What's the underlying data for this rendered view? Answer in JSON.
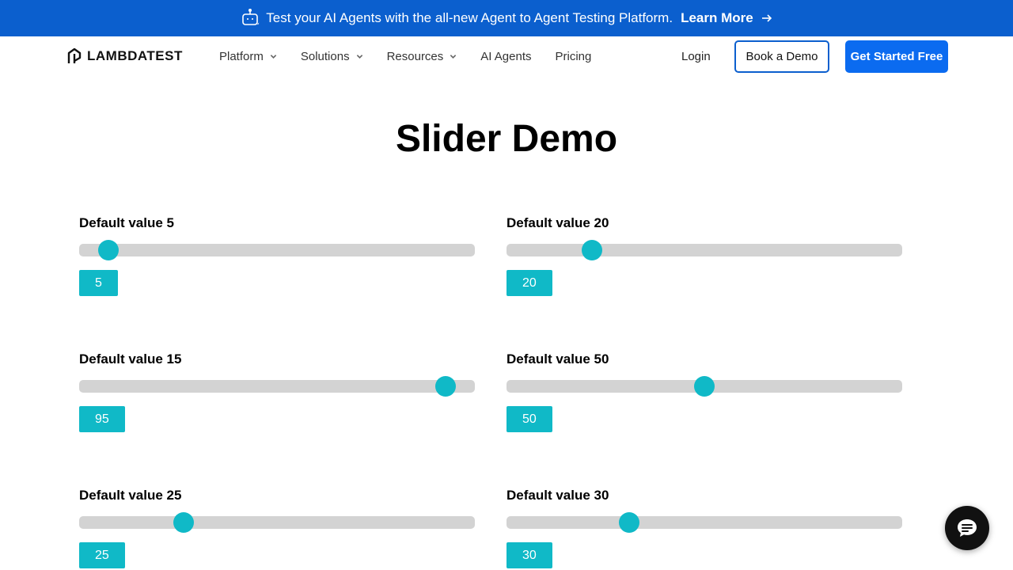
{
  "banner": {
    "icon": "robot-icon",
    "text": "Test your AI Agents with the all-new Agent to Agent Testing Platform.",
    "link": "Learn More",
    "bg_color": "#0b5fce"
  },
  "nav": {
    "logo_text": "LAMBDATEST",
    "links": [
      {
        "label": "Platform",
        "has_dropdown": true
      },
      {
        "label": "Solutions",
        "has_dropdown": true
      },
      {
        "label": "Resources",
        "has_dropdown": true
      },
      {
        "label": "AI Agents",
        "has_dropdown": false
      },
      {
        "label": "Pricing",
        "has_dropdown": false
      }
    ],
    "login": "Login",
    "book_demo": "Book a Demo",
    "get_started": "Get Started Free",
    "accent_color": "#0b6bf0"
  },
  "main": {
    "title": "Slider Demo",
    "slider_color": "#10b9c7",
    "sliders": [
      {
        "label": "Default value 5",
        "value": 5,
        "output": "5"
      },
      {
        "label": "Default value 20",
        "value": 20,
        "output": "20"
      },
      {
        "label": "Default value 15",
        "value": 95,
        "output": "95"
      },
      {
        "label": "Default value 50",
        "value": 50,
        "output": "50"
      },
      {
        "label": "Default value 25",
        "value": 25,
        "output": "25"
      },
      {
        "label": "Default value 30",
        "value": 30,
        "output": "30"
      }
    ]
  },
  "chat": {
    "icon": "chat-bubble-icon"
  }
}
